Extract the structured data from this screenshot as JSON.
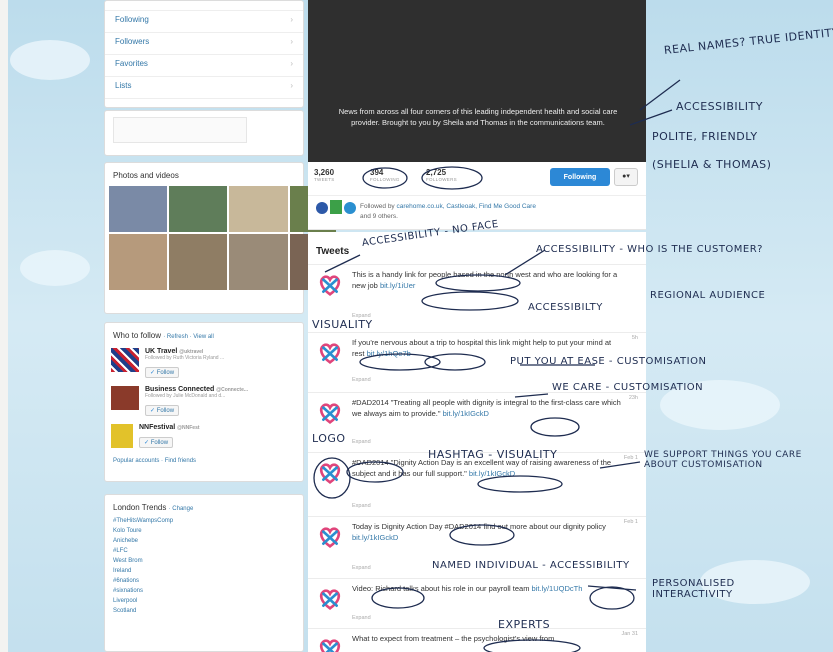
{
  "nav": {
    "items": [
      {
        "label": "Following"
      },
      {
        "label": "Followers"
      },
      {
        "label": "Favorites"
      },
      {
        "label": "Lists"
      }
    ]
  },
  "photos": {
    "header": "Photos and videos"
  },
  "who_to_follow": {
    "header": "Who to follow",
    "refresh": "· Refresh · View all",
    "items": [
      {
        "name": "UK Travel",
        "handle": "@uktravel",
        "sub": "Followed by Ruth Victoria Ryland ...",
        "follow": "Follow"
      },
      {
        "name": "Business Connected",
        "handle": "@Connecte...",
        "sub": "Followed by Julie McDonald and d...",
        "follow": "Follow"
      },
      {
        "name": "NNFestival",
        "handle": "@NNFest",
        "sub": "",
        "follow": "Follow"
      }
    ],
    "footer": "Popular accounts · Find friends"
  },
  "trends": {
    "header": "London Trends",
    "change": "· Change",
    "items": [
      "#TheHitsWampsComp",
      "Kolo Toure",
      "Anichebe",
      "#LFC",
      "West Brom",
      "Ireland",
      "#6nations",
      "#sixnations",
      "Liverpool",
      "Scotland"
    ]
  },
  "profile": {
    "bio": "News from across all four corners of this leading independent health and social care provider. Brought to you by Sheila and Thomas in the communications team.",
    "stats": [
      {
        "value": "3,260",
        "label": "TWEETS"
      },
      {
        "value": "394",
        "label": "FOLLOWING"
      },
      {
        "value": "2,725",
        "label": "FOLLOWERS"
      }
    ],
    "follow_button": "Following",
    "user_menu": "▾",
    "followed_by_prefix": "Followed by ",
    "followed_by_names": "carehome.co.uk, Castleoak, Find Me Good Care",
    "followed_by_suffix": "and 9 others."
  },
  "timeline": {
    "header": "Tweets",
    "tweets": [
      {
        "text": "This is a handy link for people based in the north west and who are looking for a new job ",
        "link": "bit.ly/1iUer",
        "expand": "Expand",
        "time": ""
      },
      {
        "text": "If you're nervous about a trip to hospital this link might help to put your mind at rest ",
        "link": "bit.ly/1hQe7b",
        "expand": "Expand",
        "time": "5h"
      },
      {
        "text": "#DAD2014 \"Treating all people with dignity is integral to the first-class care which we always aim to provide.\" ",
        "link": "bit.ly/1kIGckD",
        "expand": "Expand",
        "time": "23h"
      },
      {
        "text": "#DAD2014 \"Dignity Action Day is an excellent way of raising awareness of the subject and it has our full support.\" ",
        "link": "bit.ly/1kIGckD",
        "expand": "Expand",
        "time": "Feb 1"
      },
      {
        "text": "Today is Dignity Action Day #DAD2014 find out more about our dignity policy ",
        "link": "bit.ly/1kIGckD",
        "expand": "Expand",
        "time": "Feb 1"
      },
      {
        "text": "Video: Richard talks about his role in our payroll team ",
        "link": "bit.ly/1UQDcTh",
        "expand": "Expand",
        "time": ""
      },
      {
        "text": "What to expect from treatment – the psychologist's view from",
        "link": "",
        "expand": "",
        "time": "Jan 31"
      }
    ]
  },
  "annotations": [
    "REAL NAMES? TRUE IDENTITY",
    "ACCESSIBILITY",
    "POLITE, FRIENDLY",
    "(SHELIA & THOMAS)",
    "ACCESSIBILITY - NO FACE",
    "ACCESSIBILITY - WHO IS THE CUSTOMER?",
    "REGIONAL AUDIENCE",
    "ACCESSIBILTY",
    "VISUALITY",
    "PUT YOU AT EASE - CUSTOMISATION",
    "WE CARE - CUSTOMISATION",
    "LOGO",
    "HASHTAG - VISUALITY",
    "WE SUPPORT THINGS YOU CARE ABOUT CUSTOMISATION",
    "NAMED INDIVIDUAL - ACCESSIBILITY",
    "PERSONALISED INTERACTIVITY",
    "EXPERTS"
  ],
  "colors": {
    "accent": "#2c88d6",
    "link": "#3478a8",
    "hero": "#2f2f2f",
    "ink": "#1e2c50",
    "logo_pink": "#e0457b",
    "logo_blue": "#2a8fd0"
  }
}
